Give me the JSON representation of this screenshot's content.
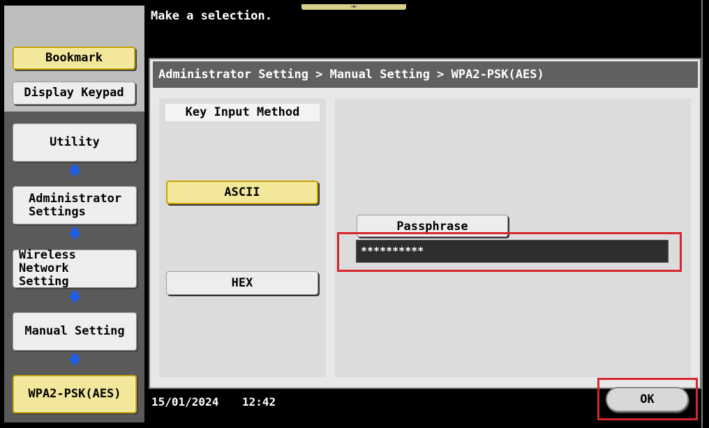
{
  "header": {
    "message": "Make a selection.",
    "breadcrumb": "Administrator Setting > Manual Setting > WPA2-PSK(AES)"
  },
  "sidebar": {
    "bookmark": "Bookmark",
    "display_keypad": "Display Keypad",
    "steps": [
      {
        "label": "Utility"
      },
      {
        "label": "Administrator\nSettings"
      },
      {
        "label": "Wireless Network\nSetting"
      },
      {
        "label": "Manual Setting"
      },
      {
        "label": "WPA2-PSK(AES)"
      }
    ],
    "arrow_icon": "arrow-down-icon"
  },
  "key_input": {
    "label": "Key Input Method",
    "options": [
      "ASCII",
      "HEX"
    ],
    "selected": "ASCII"
  },
  "passphrase": {
    "button_label": "Passphrase",
    "value": "**********"
  },
  "status": {
    "date": "15/01/2024",
    "time": "12:42"
  },
  "actions": {
    "ok_label": "OK"
  },
  "colors": {
    "highlight": "#d6262e",
    "selected_yellow": "#f2e79a",
    "arrow_blue": "#1e5ee8"
  }
}
